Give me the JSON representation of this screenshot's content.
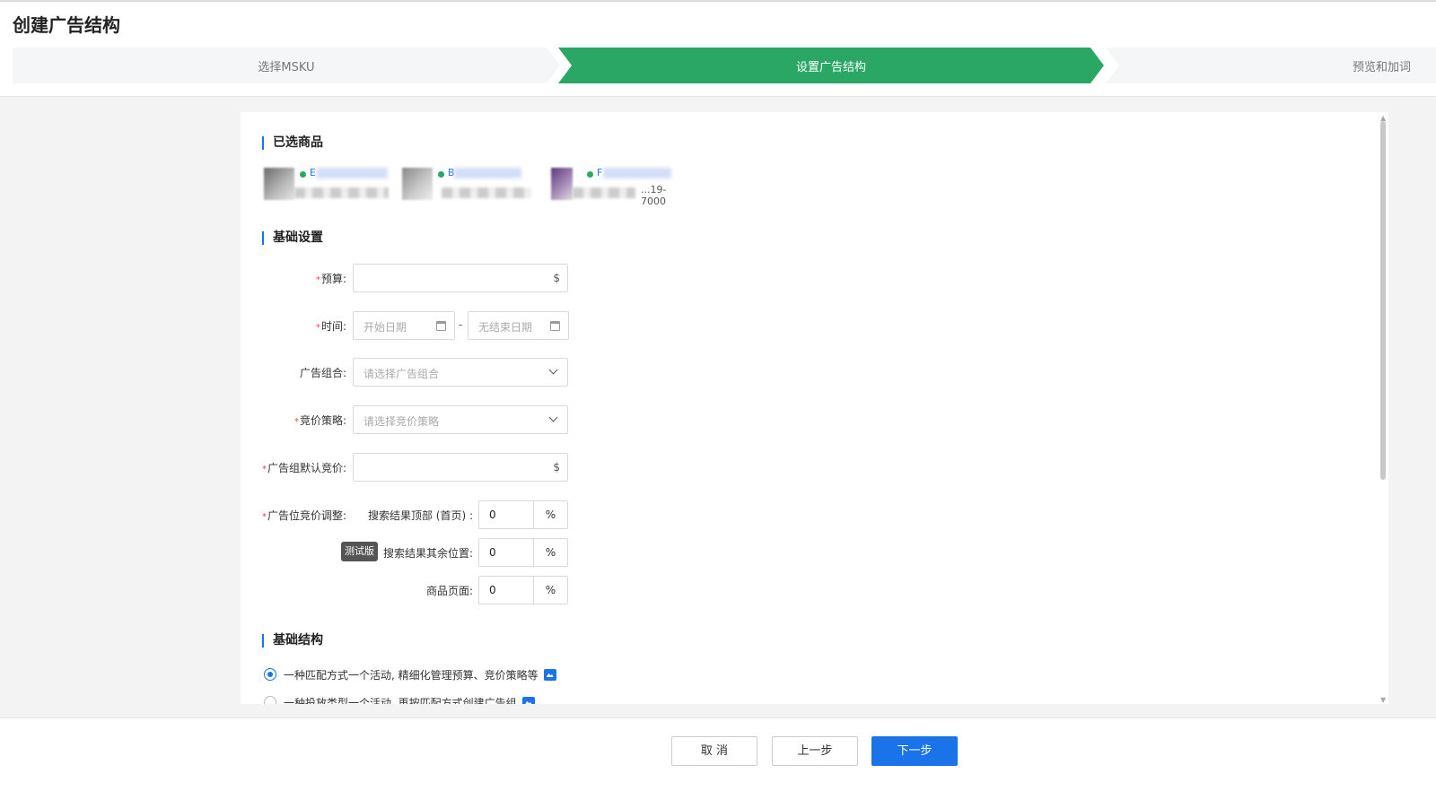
{
  "page": {
    "title": "创建广告结构"
  },
  "steps": [
    {
      "label": "选择MSKU",
      "state": "done"
    },
    {
      "label": "设置广告结构",
      "state": "active"
    },
    {
      "label": "预览和加词",
      "state": "todo"
    }
  ],
  "colors": {
    "active_step": "#2aa764",
    "primary": "#1a73e8",
    "required": "#e54545"
  },
  "selected_products": {
    "title": "已选商品",
    "items": [
      {
        "asin_prefix": "E",
        "sku": ""
      },
      {
        "asin_prefix": "B",
        "sku": ""
      },
      {
        "asin_prefix": "F",
        "sku": "...19-7000"
      }
    ]
  },
  "basic_settings": {
    "title": "基础设置",
    "budget": {
      "label": "预算:",
      "value": "",
      "suffix": "$"
    },
    "time": {
      "label": "时间:",
      "start_placeholder": "开始日期",
      "end_placeholder": "无结束日期",
      "separator": "-"
    },
    "ad_group_combo": {
      "label": "广告组合:",
      "placeholder": "请选择广告组合"
    },
    "bid_strategy": {
      "label": "竞价策略:",
      "placeholder": "请选择竞价策略"
    },
    "default_bid": {
      "label": "广告组默认竞价:",
      "value": "",
      "suffix": "$"
    },
    "placement": {
      "label": "广告位竞价调整:",
      "top_label": "搜索结果顶部 (首页) :",
      "top_value": "0",
      "rest_badge": "测试版",
      "rest_label": "搜索结果其余位置:",
      "rest_value": "0",
      "product_label": "商品页面:",
      "product_value": "0",
      "unit": "%"
    }
  },
  "basic_structure": {
    "title": "基础结构",
    "options": [
      {
        "label": "一种匹配方式一个活动, 精细化管理预算、竞价策略等",
        "selected": true
      },
      {
        "label": "一种投放类型一个活动, 再按匹配方式创建广告组",
        "selected": false
      }
    ]
  },
  "footer": {
    "cancel": "取 消",
    "prev": "上一步",
    "next": "下一步"
  }
}
